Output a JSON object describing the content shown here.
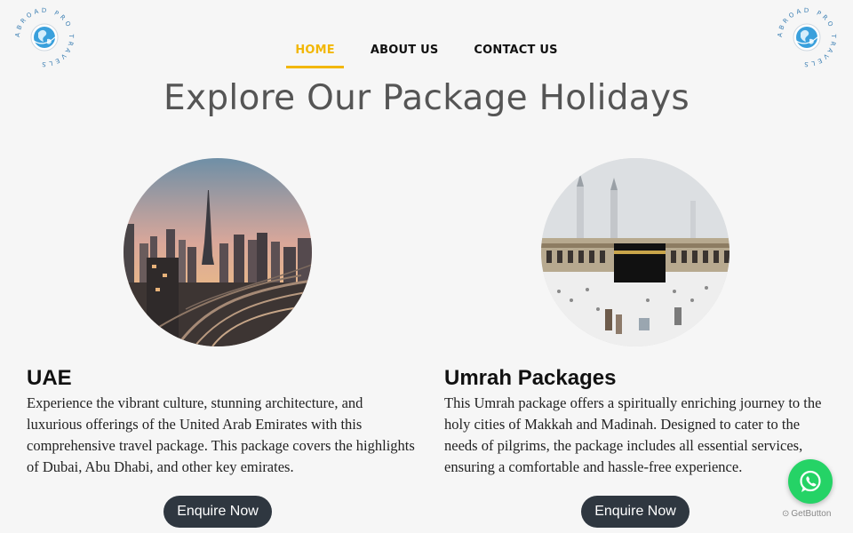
{
  "brand": {
    "logo_text": "ABROAD PRO TRAVELS"
  },
  "nav": {
    "items": [
      {
        "label": "HOME",
        "active": true
      },
      {
        "label": "ABOUT US",
        "active": false
      },
      {
        "label": "CONTACT US",
        "active": false
      }
    ]
  },
  "main": {
    "title": "Explore Our Package Holidays",
    "packages": [
      {
        "title": "UAE",
        "description": "Experience the vibrant culture, stunning architecture, and luxurious offerings of the United Arab Emirates with this comprehensive travel package. This package covers the highlights of Dubai, Abu Dhabi, and other key emirates.",
        "button_label": "Enquire Now",
        "image": "dubai-skyline-image"
      },
      {
        "title": "Umrah Packages",
        "description": "This Umrah package offers a spiritually enriching journey to the holy cities of Makkah and Madinah. Designed to cater to the needs of pilgrims, the package includes all essential services, ensuring a comfortable and hassle-free experience.",
        "button_label": "Enquire Now",
        "image": "kaaba-image"
      }
    ]
  },
  "widgets": {
    "whatsapp_icon": "whatsapp-icon",
    "getbutton_label": "GetButton"
  },
  "colors": {
    "accent": "#f2b705",
    "button_bg": "#2f3740",
    "whatsapp": "#25d366"
  }
}
